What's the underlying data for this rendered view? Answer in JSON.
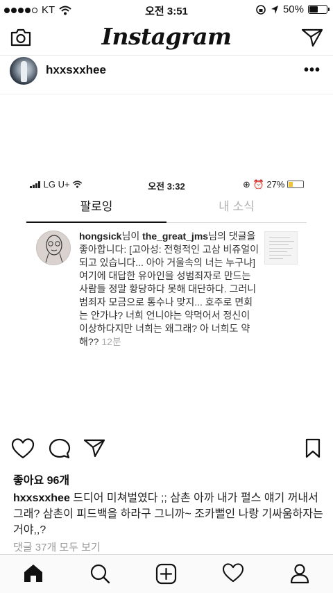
{
  "status_bar": {
    "carrier": "KT",
    "time": "오전 3:51",
    "battery": "50%",
    "battery_level": 0.5
  },
  "app": {
    "title": "Instagram"
  },
  "post": {
    "username": "hxxsxxhee",
    "likes": "좋아요 96개",
    "caption_user": "hxxsxxhee",
    "caption_text": "드디어 미쳐벌였다 ;; 삼촌 아까 내가 펄스 얘기 꺼내서 그래? 삼촌이 피드백을 하라구 그니까~ 조카뻘인 나랑 기싸움하자는거야,,?",
    "comments_link": "댓글 37개 모두 보기"
  },
  "embedded_screenshot": {
    "status": {
      "carrier": "LG U+",
      "time": "오전 3:32",
      "battery": "27%"
    },
    "tabs": {
      "following": "팔로잉",
      "you": "내 소식"
    },
    "notification": {
      "user": "hongsick",
      "suffix1": "님이",
      "target": "the_great_jms",
      "suffix2": "님의",
      "message": "댓글을 좋아합니다: [고아성: 전형적인 고삼 비쥬얼이 되고 있습니다... 아아 거울속의 너는 누구냐] 여기에 대답한 유아인을 성범죄자로 만드는 사람들 정말 황당하다 못해 대단하다. 그러니 범죄자 모금으로 통수나 맞지... 호주로 면회는 안가냐? 너희 언니야는 약먹어서 정신이 이상하다지만 너희는 왜그래? 아 너희도 약해??",
      "time": "12분"
    }
  },
  "icons": {
    "camera": "camera-icon",
    "send": "direct-send-icon",
    "more": "more-options-icon",
    "heart": "heart-icon",
    "comment": "comment-icon",
    "share": "share-icon",
    "bookmark": "bookmark-icon",
    "home": "home-icon",
    "search": "search-icon",
    "add": "add-post-icon",
    "activity": "activity-heart-icon",
    "profile": "profile-icon"
  }
}
